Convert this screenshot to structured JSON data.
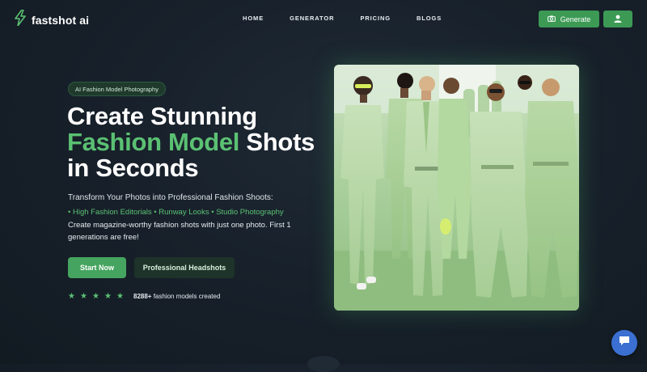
{
  "header": {
    "logo_text": "fastshot ai",
    "nav": [
      "HOME",
      "GENERATOR",
      "PRICING",
      "BLOGS"
    ],
    "generate_label": "Generate"
  },
  "hero": {
    "badge": "AI Fashion Model Photography",
    "headline_line1": "Create Stunning",
    "headline_accent": "Fashion Model",
    "headline_line2_rest": " Shots",
    "headline_line3": "in Seconds",
    "subtitle": "Transform Your Photos into Professional Fashion Shoots:",
    "features": [
      "High Fashion Editorials",
      "Runway Looks",
      "Studio Photography"
    ],
    "description": "Create magazine-worthy fashion shots with just one photo. First 1 generations are free!",
    "start_label": "Start Now",
    "headshots_label": "Professional Headshots",
    "rating": {
      "stars": 5,
      "count": "8288+",
      "count_suffix": " fashion models created"
    }
  },
  "colors": {
    "accent": "#5bc173",
    "button_green": "#3c9a55",
    "background": "#18212b",
    "chat_blue": "#3b6fd1"
  },
  "icons": {
    "logo": "lightning-icon",
    "generate": "camera-icon",
    "user": "user-icon",
    "chat": "chat-icon",
    "star": "star-icon"
  }
}
